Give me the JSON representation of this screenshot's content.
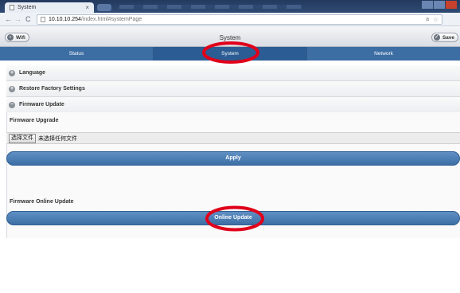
{
  "browser": {
    "tab_title": "System",
    "tab_close": "×",
    "back": "←",
    "forward": "→",
    "reload": "C",
    "url_host": "10.10.10.254",
    "url_path": "/index.html#systemPage",
    "bookmark_icon": "☆",
    "zoom_label": "a"
  },
  "header": {
    "title": "System",
    "wifi_label": "Wifi",
    "save_label": "Save"
  },
  "navbar": {
    "tabs": [
      {
        "label": "Status"
      },
      {
        "label": "System"
      },
      {
        "label": "Network"
      }
    ],
    "active": "System"
  },
  "sections": {
    "language": "Language",
    "restore": "Restore Factory Settings",
    "firmware": "Firmware Update"
  },
  "firmware": {
    "upgrade_title": "Firmware Upgrade",
    "choose_file_btn": "选择文件",
    "no_file_text": "未选择任何文件",
    "apply_label": "Apply",
    "online_title": "Firmware Online Update",
    "online_label": "Online Update"
  },
  "colors": {
    "nav_blue": "#3c6ea4",
    "annotation_red": "#e0001a"
  }
}
